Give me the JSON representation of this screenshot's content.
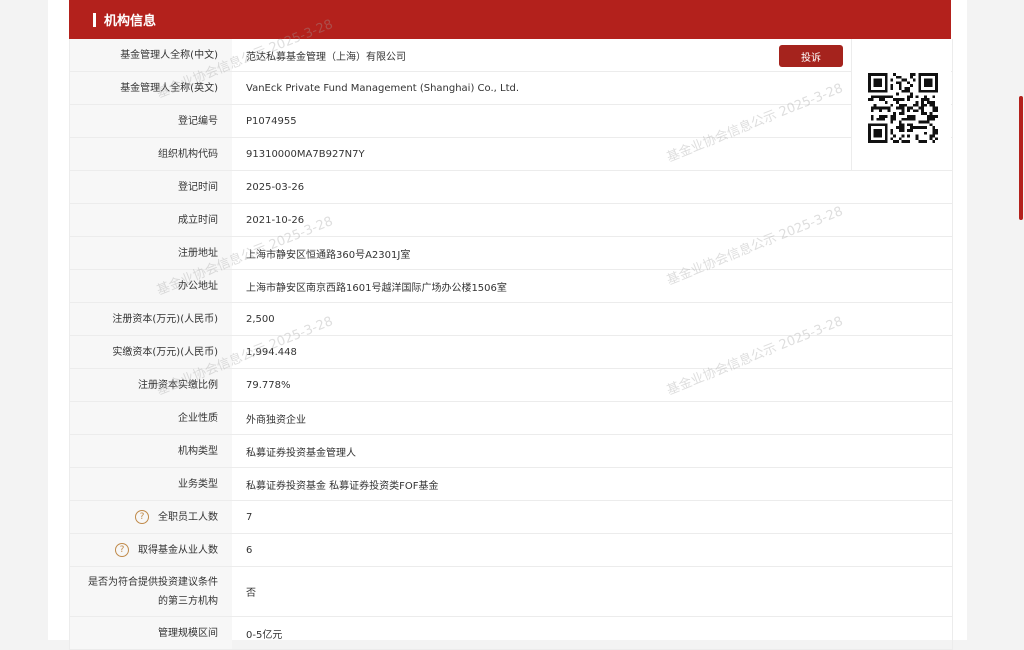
{
  "header": {
    "title": "机构信息"
  },
  "actions": {
    "complaint_label": "投诉"
  },
  "watermark": {
    "text": "基金业协会信息公示 2025-3-28"
  },
  "rows": [
    {
      "label": "基金管理人全称(中文)",
      "value": "范达私募基金管理（上海）有限公司"
    },
    {
      "label": "基金管理人全称(英文)",
      "value": "VanEck Private Fund Management (Shanghai) Co., Ltd."
    },
    {
      "label": "登记编号",
      "value": "P1074955"
    },
    {
      "label": "组织机构代码",
      "value": "91310000MA7B927N7Y"
    },
    {
      "label": "登记时间",
      "value": "2025-03-26"
    },
    {
      "label": "成立时间",
      "value": "2021-10-26"
    },
    {
      "label": "注册地址",
      "value": "上海市静安区恒通路360号A2301J室"
    },
    {
      "label": "办公地址",
      "value": "上海市静安区南京西路1601号越洋国际广场办公楼1506室"
    },
    {
      "label": "注册资本(万元)(人民币)",
      "value": "2,500"
    },
    {
      "label": "实缴资本(万元)(人民币)",
      "value": "1,994.448"
    },
    {
      "label": "注册资本实缴比例",
      "value": "79.778%"
    },
    {
      "label": "企业性质",
      "value": "外商独资企业"
    },
    {
      "label": "机构类型",
      "value": "私募证券投资基金管理人"
    },
    {
      "label": "业务类型",
      "value": "私募证券投资基金  私募证券投资类FOF基金"
    },
    {
      "label": "全职员工人数",
      "value": "7",
      "help": "?"
    },
    {
      "label": "取得基金从业人数",
      "value": "6",
      "help": "?"
    },
    {
      "label": "是否为符合提供投资建议条件的第三方机构",
      "value": "否"
    },
    {
      "label": "管理规模区间",
      "value": "0-5亿元"
    }
  ]
}
